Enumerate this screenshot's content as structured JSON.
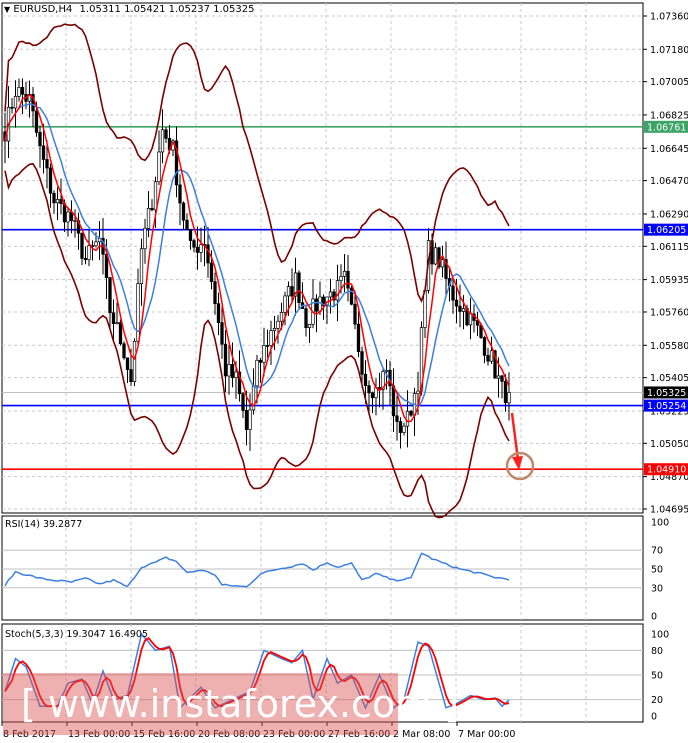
{
  "header": {
    "symbol": "EURUSD,H4",
    "ohlc": "1.05311 1.05421 1.05237 1.05325"
  },
  "colors": {
    "bull": "#000000",
    "bear": "#000000",
    "bands": "#7a0000",
    "ma_fast": "#ff0000",
    "ma_slow": "#3d7fe0",
    "green_line": "#3ca466",
    "blue_line": "#0000ff",
    "red_line": "#ff0000",
    "circle": "#c0876a"
  },
  "chart_data": {
    "type": "candlestick",
    "price_axis": {
      "min": 1.04695,
      "max": 1.0736,
      "ticks": [
        "1.07360",
        "1.07180",
        "1.07005",
        "1.06825",
        "1.06645",
        "1.06470",
        "1.06290",
        "1.06115",
        "1.05935",
        "1.05760",
        "1.05580",
        "1.05405",
        "1.05225",
        "1.05050",
        "1.04870",
        "1.04695"
      ]
    },
    "levels": [
      {
        "name": "resistance-green",
        "value": 1.06761,
        "label": "1.06761",
        "color": "#3ca466"
      },
      {
        "name": "resistance-blue",
        "value": 1.06205,
        "label": "1.06205",
        "color": "#0000ff"
      },
      {
        "name": "support-blue",
        "value": 1.05254,
        "label": "1.05254",
        "color": "#0000ff"
      },
      {
        "name": "target-red",
        "value": 1.0491,
        "label": "1.04910",
        "color": "#ff0000"
      },
      {
        "name": "current-price",
        "value": 1.05325,
        "label": "1.05325",
        "color": "#000000"
      }
    ],
    "close_waypoints": [
      [
        0,
        1.06744
      ],
      [
        3,
        1.0696
      ],
      [
        7,
        1.06906
      ],
      [
        10,
        1.06636
      ],
      [
        14,
        1.06365
      ],
      [
        19,
        1.06257
      ],
      [
        23,
        1.06041
      ],
      [
        27,
        1.06149
      ],
      [
        30,
        1.05771
      ],
      [
        34,
        1.05554
      ],
      [
        36,
        1.05392
      ],
      [
        39,
        1.06095
      ],
      [
        42,
        1.06365
      ],
      [
        45,
        1.06744
      ],
      [
        48,
        1.06636
      ],
      [
        50,
        1.06365
      ],
      [
        53,
        1.06095
      ],
      [
        57,
        1.06149
      ],
      [
        60,
        1.05825
      ],
      [
        63,
        1.05446
      ],
      [
        66,
        1.05392
      ],
      [
        69,
        1.05122
      ],
      [
        72,
        1.05446
      ],
      [
        75,
        1.05608
      ],
      [
        79,
        1.05771
      ],
      [
        83,
        1.05933
      ],
      [
        86,
        1.05717
      ],
      [
        90,
        1.05825
      ],
      [
        95,
        1.05879
      ],
      [
        97,
        1.05933
      ],
      [
        100,
        1.05663
      ],
      [
        103,
        1.05392
      ],
      [
        106,
        1.05338
      ],
      [
        109,
        1.05446
      ],
      [
        112,
        1.05122
      ],
      [
        115,
        1.05176
      ],
      [
        118,
        1.05392
      ],
      [
        121,
        1.06095
      ],
      [
        124,
        1.06041
      ],
      [
        127,
        1.05879
      ],
      [
        131,
        1.05771
      ],
      [
        135,
        1.05663
      ],
      [
        139,
        1.055
      ],
      [
        142,
        1.05338
      ],
      [
        144,
        1.05311
      ]
    ],
    "candle_count": 145,
    "time_labels": [
      "8 Feb 2017",
      "13 Feb 00:00",
      "15 Feb 16:00",
      "20 Feb 08:00",
      "23 Feb 00:00",
      "27 Feb 16:00",
      "2 Mar 08:00",
      "7 Mar 00:00"
    ],
    "rsi": {
      "label": "RSI(14) 39.2877",
      "ticks": [
        "100",
        "70",
        "50",
        "30",
        "0"
      ],
      "waypoints": [
        [
          0,
          33
        ],
        [
          3,
          47
        ],
        [
          7,
          43
        ],
        [
          10,
          40
        ],
        [
          14,
          38
        ],
        [
          19,
          36
        ],
        [
          23,
          40
        ],
        [
          27,
          34
        ],
        [
          31,
          38
        ],
        [
          35,
          31
        ],
        [
          39,
          52
        ],
        [
          43,
          57
        ],
        [
          46,
          62
        ],
        [
          49,
          58
        ],
        [
          52,
          46
        ],
        [
          56,
          49
        ],
        [
          60,
          44
        ],
        [
          62,
          33
        ],
        [
          66,
          32
        ],
        [
          69,
          31
        ],
        [
          73,
          45
        ],
        [
          78,
          50
        ],
        [
          82,
          53
        ],
        [
          85,
          56
        ],
        [
          88,
          49
        ],
        [
          92,
          57
        ],
        [
          95,
          52
        ],
        [
          99,
          56
        ],
        [
          102,
          38
        ],
        [
          106,
          45
        ],
        [
          111,
          38
        ],
        [
          116,
          40
        ],
        [
          119,
          67
        ],
        [
          122,
          61
        ],
        [
          126,
          55
        ],
        [
          130,
          50
        ],
        [
          136,
          45
        ],
        [
          140,
          41
        ],
        [
          144,
          39.29
        ]
      ]
    },
    "stoch": {
      "label": "Stoch(5,3,3) 19.3047 16.4905",
      "ticks": [
        "100",
        "80",
        "50",
        "20",
        "0"
      ],
      "main_waypoints": [
        [
          0,
          30
        ],
        [
          3,
          70
        ],
        [
          6,
          60
        ],
        [
          10,
          12
        ],
        [
          15,
          12
        ],
        [
          18,
          40
        ],
        [
          22,
          45
        ],
        [
          25,
          15
        ],
        [
          28,
          55
        ],
        [
          31,
          20
        ],
        [
          35,
          25
        ],
        [
          39,
          100
        ],
        [
          43,
          80
        ],
        [
          47,
          85
        ],
        [
          50,
          10
        ],
        [
          56,
          35
        ],
        [
          60,
          10
        ],
        [
          65,
          20
        ],
        [
          70,
          30
        ],
        [
          74,
          80
        ],
        [
          79,
          70
        ],
        [
          82,
          65
        ],
        [
          85,
          80
        ],
        [
          88,
          20
        ],
        [
          92,
          70
        ],
        [
          95,
          40
        ],
        [
          99,
          50
        ],
        [
          103,
          10
        ],
        [
          107,
          50
        ],
        [
          111,
          10
        ],
        [
          114,
          20
        ],
        [
          118,
          90
        ],
        [
          121,
          85
        ],
        [
          126,
          10
        ],
        [
          129,
          15
        ],
        [
          133,
          25
        ],
        [
          137,
          20
        ],
        [
          140,
          22
        ],
        [
          142,
          12
        ],
        [
          144,
          19.3
        ]
      ]
    }
  },
  "watermark": "[ www.instaforex.com ]"
}
